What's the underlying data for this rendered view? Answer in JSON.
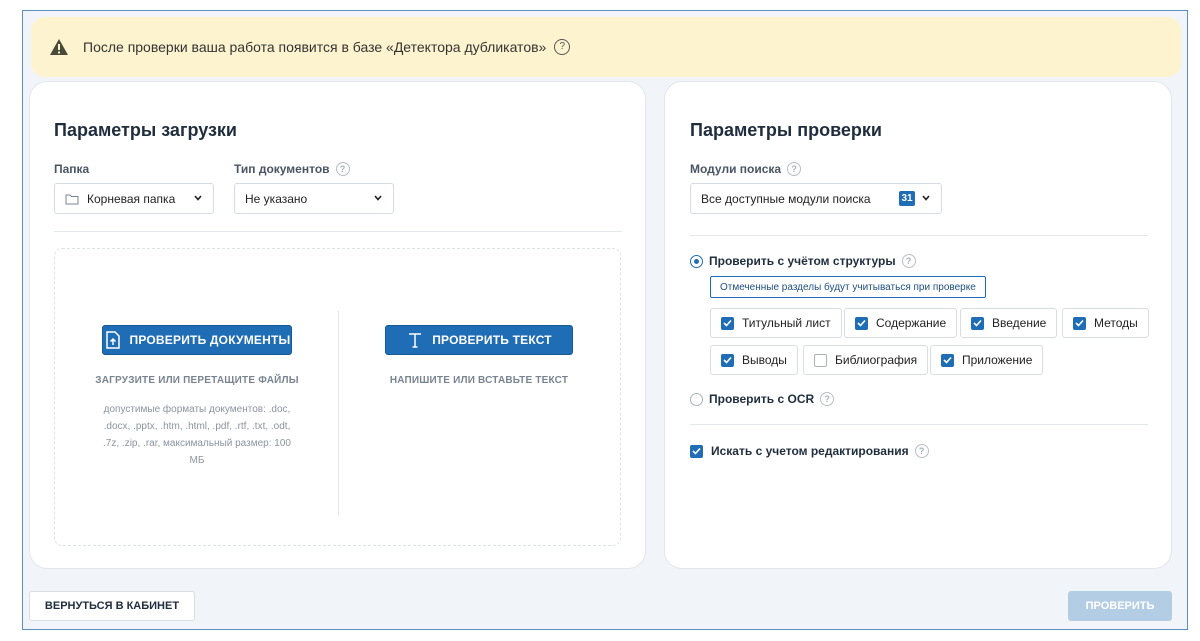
{
  "banner": {
    "text": "После проверки ваша работа появится в базе «Детектора дубликатов»",
    "icon": "warning-icon",
    "background": "#fdf4cf"
  },
  "upload": {
    "title": "Параметры загрузки",
    "folder_label": "Папка",
    "folder_value": "Корневая папка",
    "doctype_label": "Тип документов",
    "doctype_value": "Не указано",
    "check_docs_button": "ПРОВЕРИТЬ ДОКУМЕНТЫ",
    "check_docs_hint": "ЗАГРУЗИТЕ ИЛИ ПЕРЕТАЩИТЕ ФАЙЛЫ",
    "formats_line1": "допустимые форматы документов: .doc,",
    "formats_line2": ".docx, .pptx, .htm, .html, .pdf, .rtf, .txt, .odt,",
    "formats_line3": ".7z, .zip, .rar, максимальный размер: 100",
    "formats_line4": "МБ",
    "check_text_button": "ПРОВЕРИТЬ ТЕКСТ",
    "check_text_hint": "НАПИШИТЕ ИЛИ ВСТАВЬТЕ ТЕКСТ"
  },
  "check": {
    "title": "Параметры проверки",
    "modules_label": "Модули поиска",
    "modules_value": "Все доступные модули поиска",
    "modules_count": "31",
    "structure_option": "Проверить с учётом структуры",
    "structure_selected": true,
    "structure_tooltip": "Отмеченные разделы будут учитываться при проверке",
    "sections": [
      {
        "label": "Титульный лист",
        "checked": true
      },
      {
        "label": "Содержание",
        "checked": true
      },
      {
        "label": "Введение",
        "checked": true
      },
      {
        "label": "Методы",
        "checked": true
      },
      {
        "label": "Выводы",
        "checked": true
      },
      {
        "label": "Библиография",
        "checked": false
      },
      {
        "label": "Приложение",
        "checked": true
      }
    ],
    "ocr_option": "Проверить с OCR",
    "ocr_selected": false,
    "editing_option": "Искать с учетом редактирования",
    "editing_checked": true
  },
  "footer": {
    "back_button": "ВЕРНУТЬСЯ В КАБИНЕТ",
    "submit_button": "ПРОВЕРИТЬ"
  },
  "colors": {
    "accent": "#1f6db5",
    "disabled_button": "#b3cde4",
    "page_background": "#f1f5f9"
  }
}
